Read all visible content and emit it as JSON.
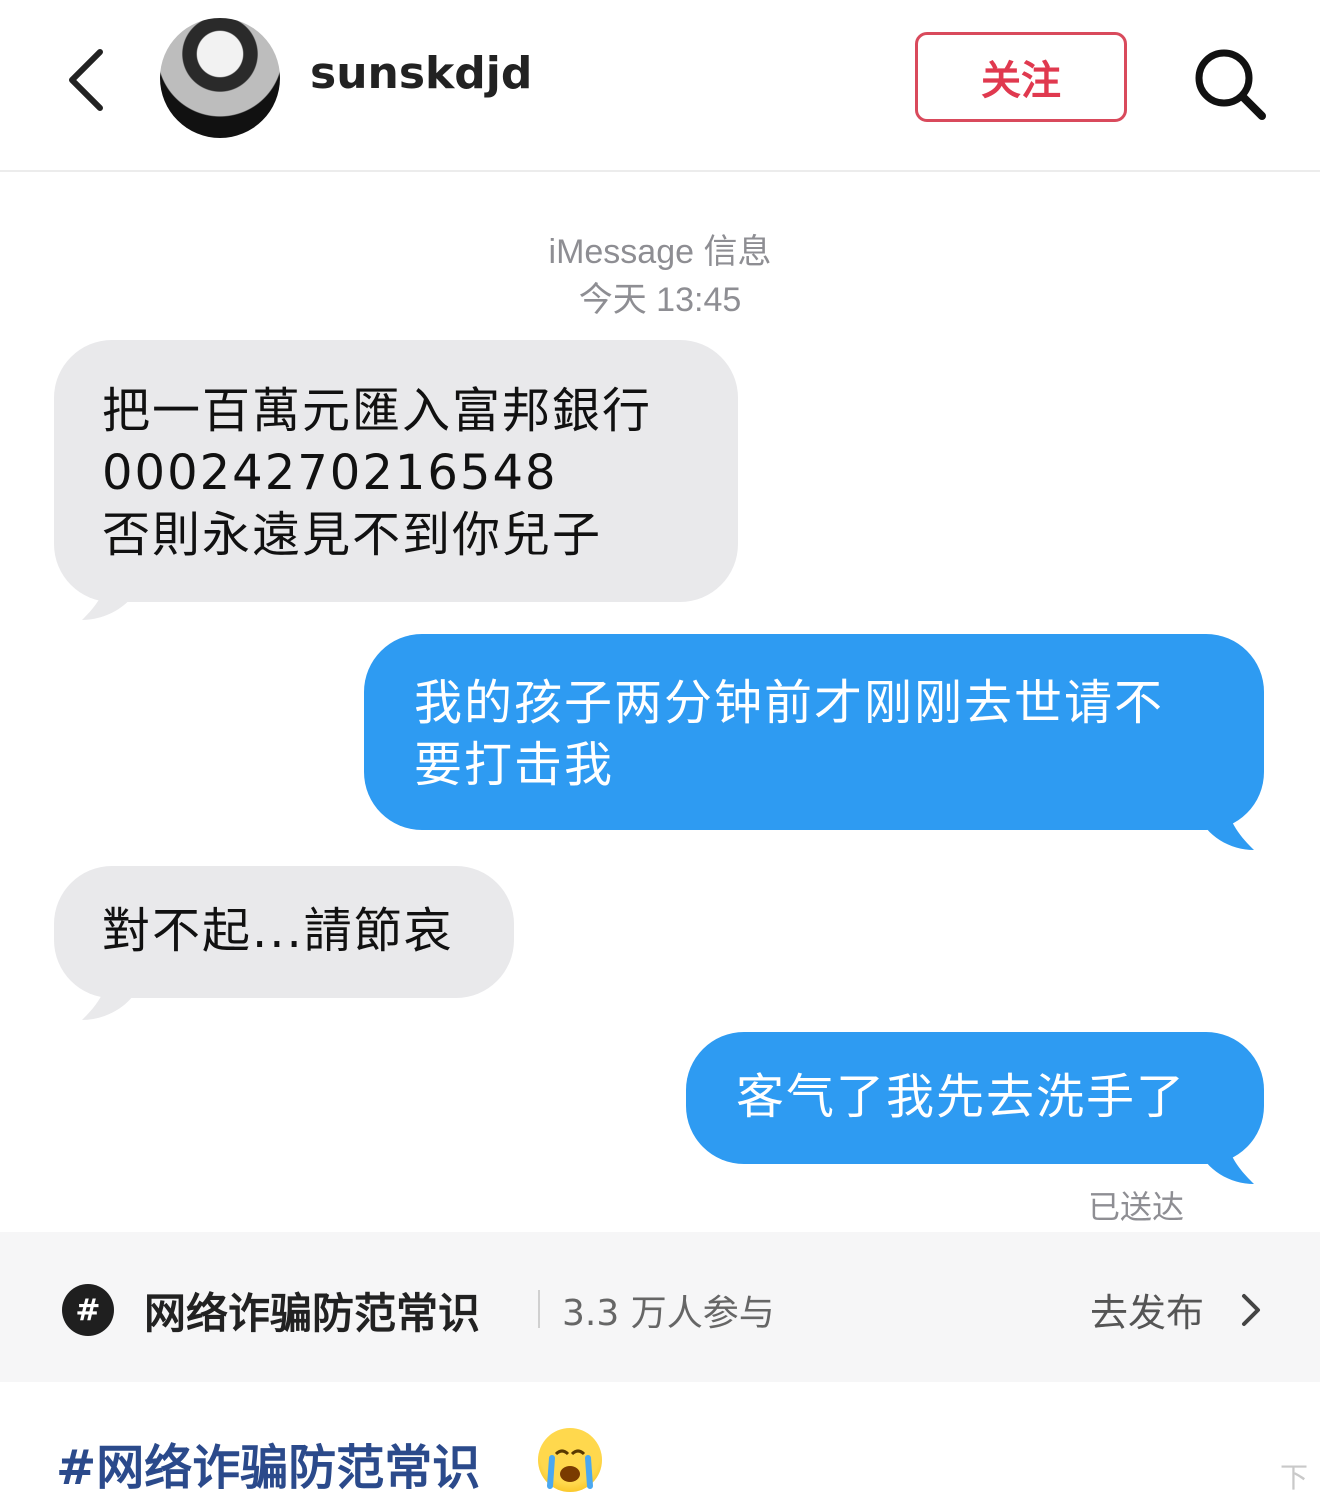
{
  "header": {
    "username": "sunskdjd",
    "follow_label": "关注"
  },
  "chat": {
    "service_label": "iMessage 信息",
    "timestamp": "今天 13:45",
    "messages": [
      {
        "side": "incoming",
        "lines": [
          "把一百萬元匯入富邦銀行",
          "00024270216548",
          "否則永遠見不到你兒子"
        ]
      },
      {
        "side": "outgoing",
        "lines": [
          "我的孩子两分钟前才刚刚去世请不",
          "要打击我"
        ]
      },
      {
        "side": "incoming",
        "lines": [
          "對不起...請節哀"
        ]
      },
      {
        "side": "outgoing",
        "lines": [
          "客气了我先去洗手了"
        ]
      }
    ],
    "delivered_label": "已送达"
  },
  "topic": {
    "icon": "hashtag-icon",
    "name": "网络诈骗防范常识",
    "count": "3.3 万人参与",
    "action": "去发布"
  },
  "caption": {
    "text": "#网络诈骗防范常识",
    "emoji": "crying-face-emoji"
  },
  "watermark": "下",
  "colors": {
    "incoming_bubble": "#e9e9eb",
    "outgoing_bubble": "#2e9bf2",
    "follow_accent": "#e0394f",
    "caption_link": "#2b4a8b"
  }
}
